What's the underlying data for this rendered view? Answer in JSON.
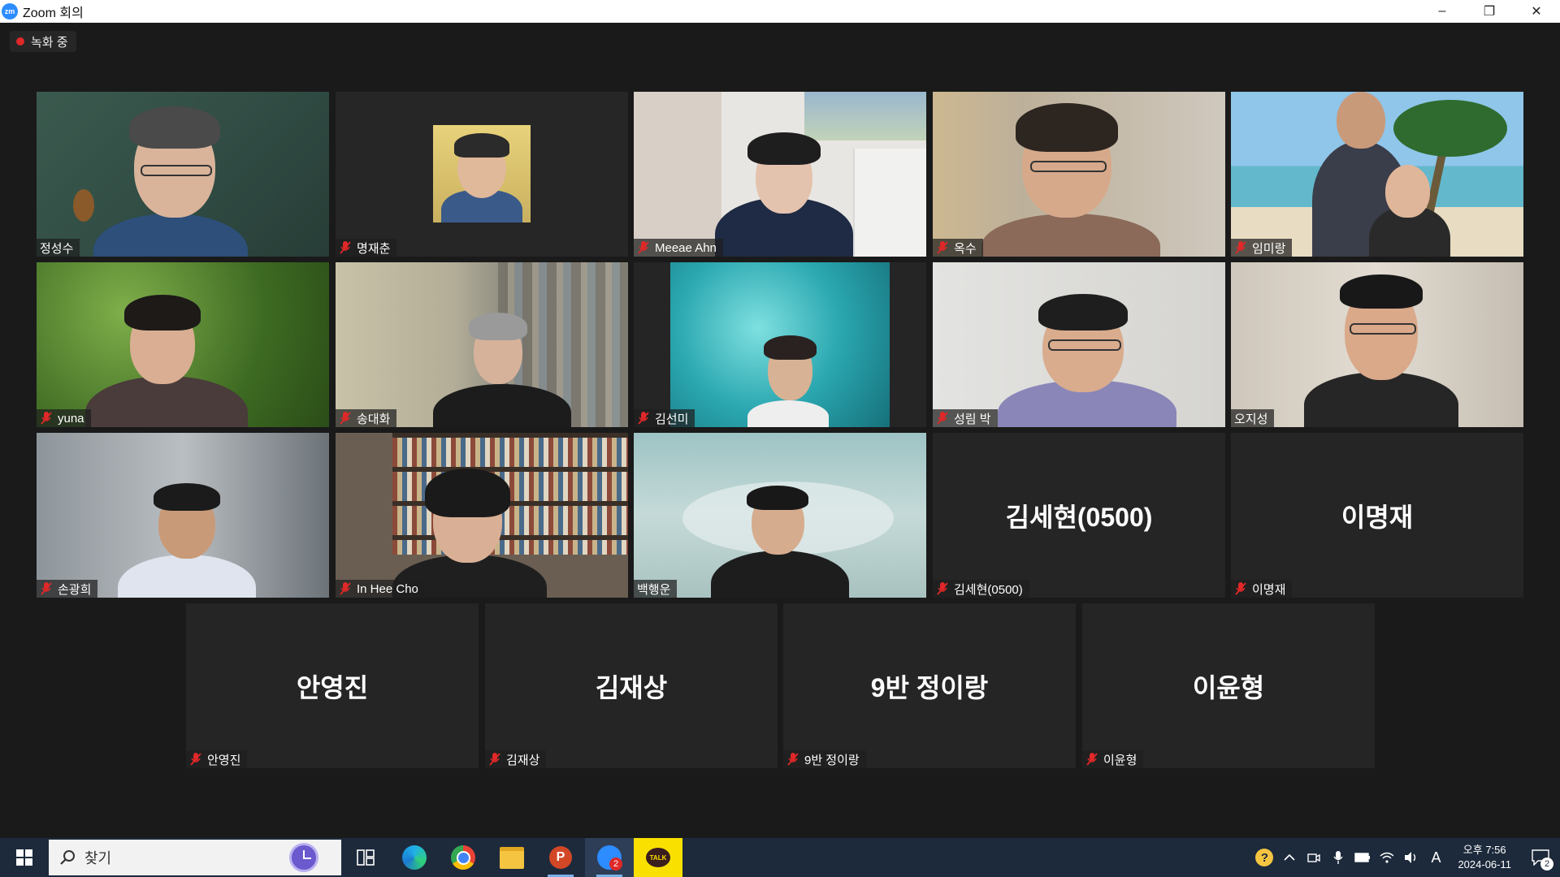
{
  "window": {
    "title": "Zoom 회의",
    "app_icon_text": "zm",
    "minimize": "–",
    "restore": "❐",
    "close": "✕"
  },
  "recording": {
    "label": "녹화 중",
    "color": "#e02828"
  },
  "participants": [
    {
      "name": "정성수",
      "muted": false,
      "video": true
    },
    {
      "name": "명재춘",
      "muted": true,
      "video": true
    },
    {
      "name": "Meeae Ahn",
      "muted": true,
      "video": true
    },
    {
      "name": "옥수",
      "muted": true,
      "video": true
    },
    {
      "name": "임미랑",
      "muted": true,
      "video": true
    },
    {
      "name": "yuna",
      "muted": true,
      "video": true
    },
    {
      "name": "송대화",
      "muted": true,
      "video": true
    },
    {
      "name": "김선미",
      "muted": true,
      "video": true
    },
    {
      "name": "성림 박",
      "muted": true,
      "video": true
    },
    {
      "name": "오지성",
      "muted": false,
      "video": true,
      "active_speaker": true
    },
    {
      "name": "손광희",
      "muted": true,
      "video": true
    },
    {
      "name": "In Hee Cho",
      "muted": true,
      "video": true
    },
    {
      "name": "백행운",
      "muted": false,
      "video": true
    },
    {
      "name": "김세현(0500)",
      "muted": true,
      "video": false
    },
    {
      "name": "이명재",
      "muted": true,
      "video": false
    },
    {
      "name": "안영진",
      "muted": true,
      "video": false
    },
    {
      "name": "김재상",
      "muted": true,
      "video": false
    },
    {
      "name": "9반 정이랑",
      "muted": true,
      "video": false
    },
    {
      "name": "이윤형",
      "muted": true,
      "video": false
    }
  ],
  "colors": {
    "active_speaker_border": "#d6ea5a",
    "mic_off": "#e02828"
  },
  "taskbar": {
    "search_placeholder": "찾기",
    "apps": [
      "task-view",
      "edge",
      "chrome",
      "file-explorer",
      "powerpoint",
      "zoom",
      "kakaotalk"
    ],
    "zoom_badge": "2",
    "ime": "A",
    "time": "오후 7:56",
    "date": "2024-06-11",
    "notification_count": "2"
  }
}
